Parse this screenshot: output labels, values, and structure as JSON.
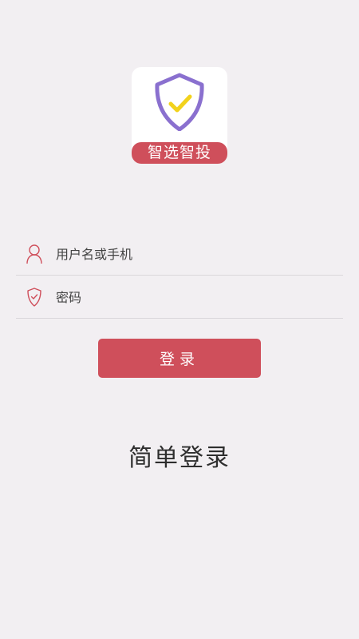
{
  "app": {
    "logo_text": "智选智投",
    "colors": {
      "brand": "#cf4f5b",
      "shield_stroke": "#8a70cf",
      "check": "#f2d21c",
      "background": "#f2eff2"
    }
  },
  "form": {
    "username": {
      "placeholder": "用户名或手机",
      "value": "",
      "icon": "user-icon"
    },
    "password": {
      "placeholder": "密码",
      "value": "",
      "icon": "shield-check-icon"
    },
    "login_label": "登录"
  },
  "simple_login_label": "简单登录"
}
